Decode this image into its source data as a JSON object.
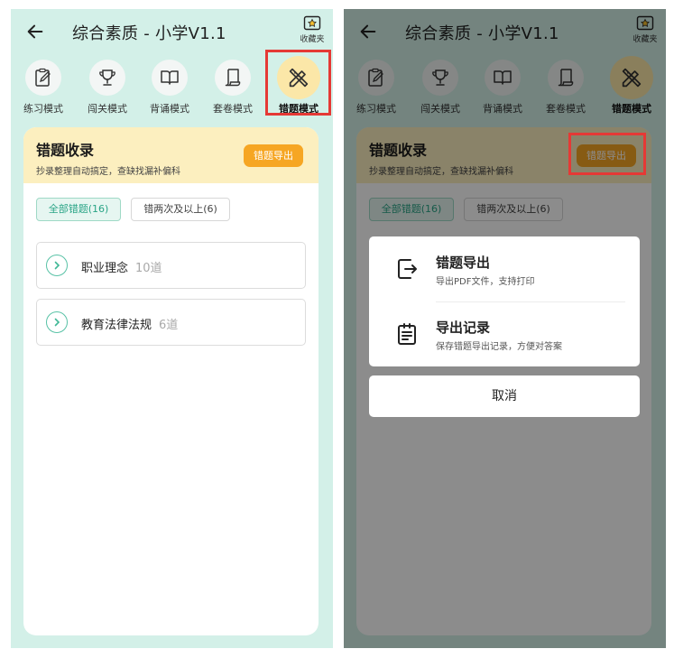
{
  "app": {
    "title": "综合素质 - 小学V1.1",
    "favorites_label": "收藏夹"
  },
  "modes": [
    {
      "label": "练习模式",
      "icon": "clipboard-edit-icon"
    },
    {
      "label": "闯关模式",
      "icon": "trophy-icon"
    },
    {
      "label": "背诵模式",
      "icon": "open-book-icon"
    },
    {
      "label": "套卷模式",
      "icon": "scroll-icon"
    },
    {
      "label": "错题模式",
      "icon": "pencil-ruler-icon",
      "active": true
    }
  ],
  "banner": {
    "title": "错题收录",
    "subtitle": "抄录整理自动搞定，查缺找漏补偏科",
    "export_label": "错题导出"
  },
  "filters": [
    {
      "label": "全部错题(16)",
      "selected": true
    },
    {
      "label": "错两次及以上(6)",
      "selected": false
    }
  ],
  "categories": [
    {
      "name": "职业理念",
      "count": "10道"
    },
    {
      "name": "教育法律法规",
      "count": "6道"
    }
  ],
  "sheet": {
    "items": [
      {
        "title": "错题导出",
        "subtitle": "导出PDF文件，支持打印",
        "icon": "export-file-icon"
      },
      {
        "title": "导出记录",
        "subtitle": "保存错题导出记录，方便对答案",
        "icon": "record-list-icon"
      }
    ],
    "cancel_label": "取消"
  },
  "colors": {
    "background": "#d3f0e8",
    "banner": "#fcefbf",
    "accent_orange": "#f6a623",
    "accent_green": "#29a486",
    "highlight_red": "#e53935"
  }
}
